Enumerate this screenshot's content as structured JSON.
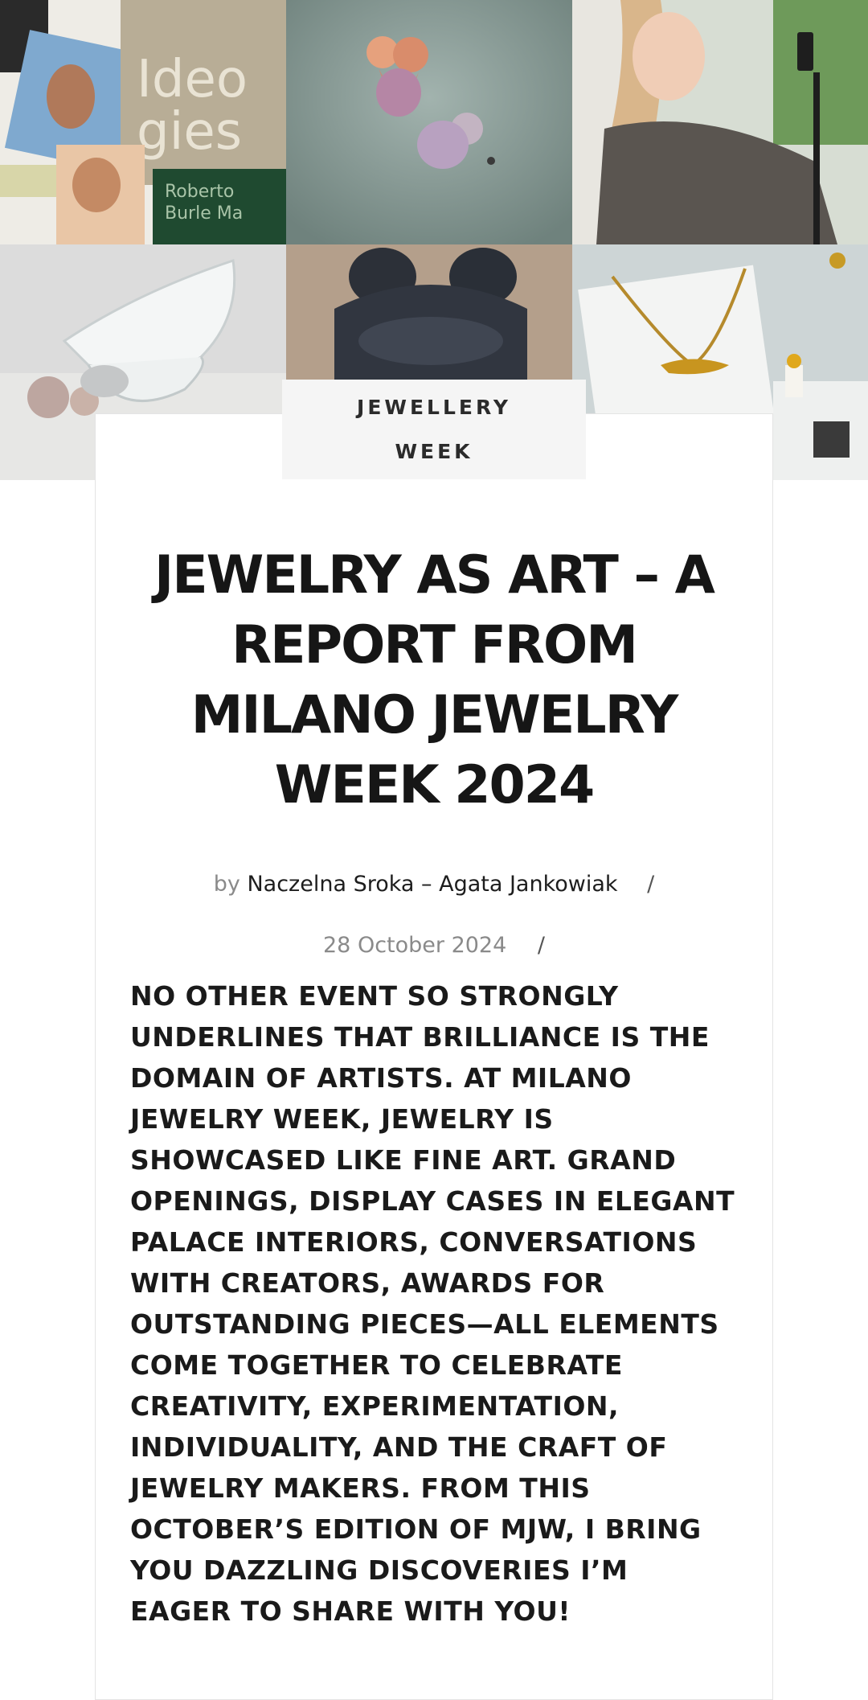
{
  "hero": {
    "image_count": 6,
    "images": [
      {
        "name": "magazine-collage",
        "text_ideologies": "Ideologies",
        "text_book": "Roberto Burle Marx Lectures"
      },
      {
        "name": "rose-gold-earrings"
      },
      {
        "name": "woman-photographing-with-phone"
      },
      {
        "name": "glass-sculpture-with-pearls"
      },
      {
        "name": "dark-monkey-sculpture"
      },
      {
        "name": "gold-lizard-necklace"
      }
    ]
  },
  "article": {
    "category": "JEWELLERY WEEK",
    "title": "JEWELRY AS ART – A REPORT FROM MILANO JEWELRY WEEK 2024",
    "byline_prefix": "by",
    "author": "Naczelna Sroka – Agata Jankowiak",
    "separator": "/",
    "date": "28 October 2024",
    "lead": "No other event so strongly underlines that brilliance is the domain of artists. At Milano Jewelry Week, jewelry is showcased like fine art. Grand openings, display cases in elegant palace interiors, conversations with creators, awards for outstanding pieces—all elements come together to celebrate creativity, experimentation, individuality, and the craft of jewelry makers. From this October’s edition of MJW, I bring you dazzling discoveries I’m eager to share with you!"
  },
  "colors": {
    "text": "#161616",
    "muted": "#8a8a8a",
    "tag_bg": "#f5f5f5",
    "card_border": "#e4e4e4"
  }
}
